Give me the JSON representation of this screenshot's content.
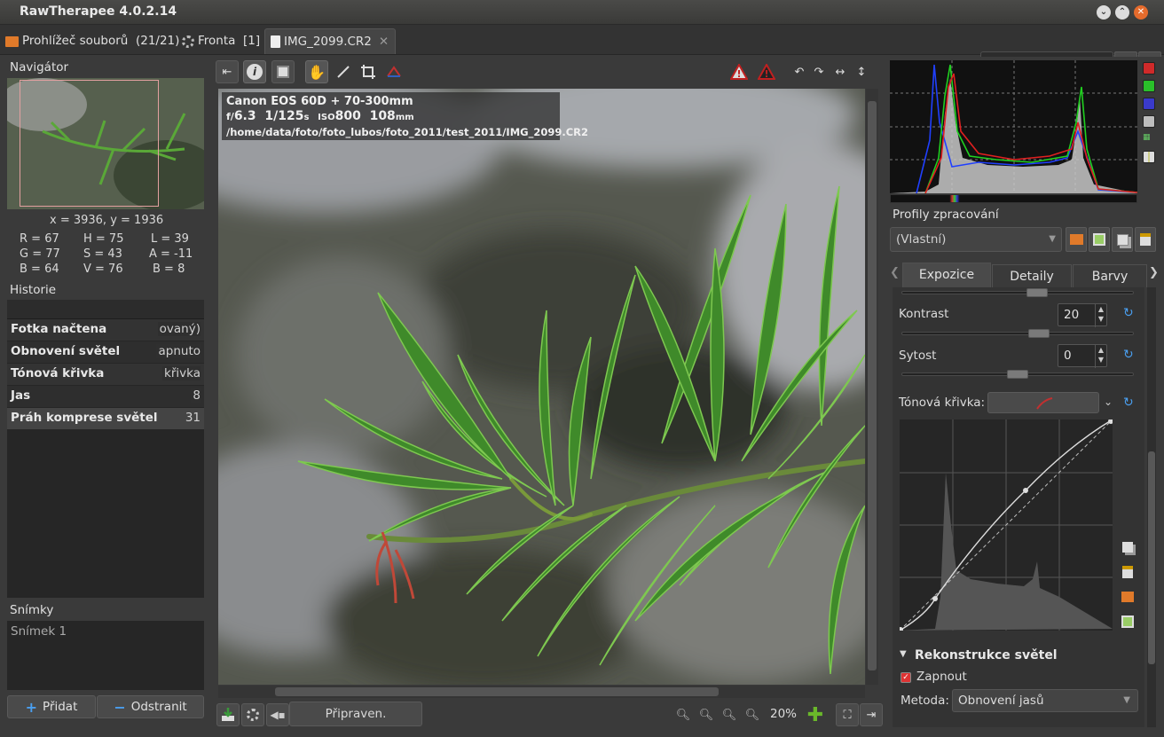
{
  "window": {
    "title": "RawTherapee 4.0.2.14"
  },
  "tabs": [
    {
      "label": "Prohlížeč souborů",
      "count": "(21/21)"
    },
    {
      "label": "Fronta",
      "count": "[1]"
    },
    {
      "label": "IMG_2099.CR2",
      "close": "✕"
    }
  ],
  "navigator": {
    "title": "Navigátor",
    "coords": "x = 3936, y = 1936",
    "values": [
      [
        "R = 67",
        "H = 75",
        "L = 39"
      ],
      [
        "G = 77",
        "S = 43",
        "A = -11"
      ],
      [
        "B = 64",
        "V = 76",
        "B = 8"
      ]
    ]
  },
  "history": {
    "title": "Historie",
    "rows": [
      {
        "name": "Fotka načtena",
        "value": "ovaný)"
      },
      {
        "name": "Obnovení světel",
        "value": "apnuto"
      },
      {
        "name": "Tónová křivka",
        "value": "křivka"
      },
      {
        "name": "Jas",
        "value": "8"
      },
      {
        "name": "Práh komprese světel",
        "value": "31"
      }
    ]
  },
  "snapshots": {
    "title": "Snímky",
    "items": [
      "Snímek 1"
    ],
    "add": "Přidat",
    "remove": "Odstranit"
  },
  "image_info": {
    "line1": "Canon EOS 60D + 70-300mm",
    "aperture_prefix": "f/",
    "aperture": "6.3",
    "shutter": "1/125",
    "shutter_unit": "s",
    "iso_label": "ISO",
    "iso": "800",
    "focal": "108",
    "focal_unit": "mm",
    "path": "/home/data/foto/foto_lubos/foto_2011/test_2011/IMG_2099.CR2"
  },
  "status": {
    "text": "Připraven.",
    "zoom": "20%"
  },
  "profiles": {
    "title": "Profily zpracování",
    "selected": "(Vlastní)"
  },
  "right_tabs": [
    "Expozice",
    "Detaily",
    "Barvy"
  ],
  "exposure": {
    "contrast_label": "Kontrast",
    "contrast_value": "20",
    "contrast_level": 0.6,
    "saturation_label": "Sytost",
    "saturation_value": "0",
    "saturation_level": 0.5,
    "tone_curve_label": "Tónová křivka:",
    "section": "Rekonstrukce světel",
    "enable_label": "Zapnout",
    "method_label": "Metoda:",
    "method_value": "Obnovení jasů"
  },
  "colors": {
    "accent": "#4a9ff0",
    "nav_rect": "#e3a0a0",
    "hist_red": "#e02020",
    "hist_green": "#20d020",
    "hist_blue": "#2040ff"
  }
}
